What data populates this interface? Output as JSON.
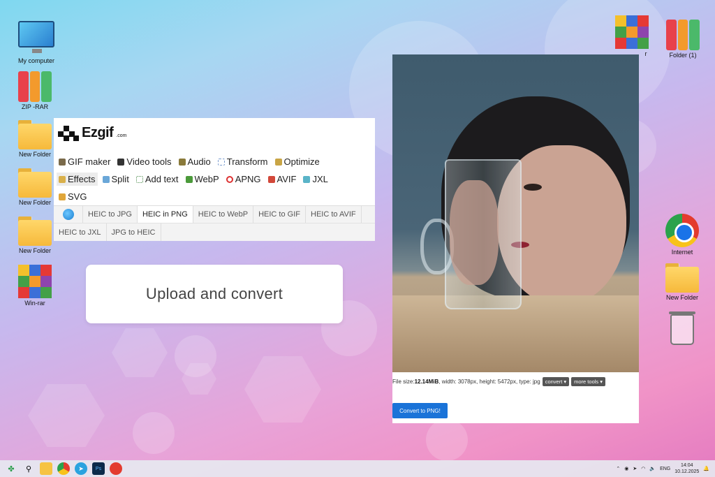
{
  "desktop": {
    "left_icons": [
      {
        "label": "My computer"
      },
      {
        "label": "ZIP -RAR"
      },
      {
        "label": "New Folder"
      },
      {
        "label": "New Folder"
      },
      {
        "label": "New Folder"
      },
      {
        "label": "Win-rar"
      }
    ],
    "right_icons": [
      {
        "label": "r"
      },
      {
        "label": "Folder (1)"
      },
      {
        "label": "Internet"
      },
      {
        "label": "New Folder"
      },
      {
        "label": ""
      }
    ]
  },
  "ezgif": {
    "logo_text": "Ezgif",
    "logo_suffix": ".com",
    "nav_rows": [
      [
        {
          "label": "GIF maker",
          "icon": "film-icon"
        },
        {
          "label": "Video tools",
          "icon": "clapper-icon"
        },
        {
          "label": "Audio",
          "icon": "speaker-icon"
        },
        {
          "label": "Transform",
          "icon": "transform-icon"
        },
        {
          "label": "Optimize",
          "icon": "broom-icon"
        }
      ],
      [
        {
          "label": "Effects",
          "icon": "wand-icon",
          "active": true
        },
        {
          "label": "Split",
          "icon": "scissors-icon"
        },
        {
          "label": "Add text",
          "icon": "text-icon"
        },
        {
          "label": "WebP",
          "icon": "webp-icon"
        },
        {
          "label": "APNG",
          "icon": "apng-icon"
        },
        {
          "label": "AVIF",
          "icon": "avif-icon"
        },
        {
          "label": "JXL",
          "icon": "jxl-icon"
        }
      ],
      [
        {
          "label": "SVG",
          "icon": "svg-icon"
        }
      ]
    ],
    "tabs_row1": [
      "HEIC to JPG",
      "HEIC in PNG",
      "HEIC to WebP",
      "HEIC to GIF",
      "HEIC to AVIF"
    ],
    "tabs_row2": [
      "HEIC to JXL",
      "JPG to HEIC"
    ],
    "active_tab": "HEIC in PNG"
  },
  "upload": {
    "label": "Upload and convert"
  },
  "file": {
    "size_label": "File size: ",
    "size_value": "12.14MiB",
    "details": ", width: 3078px, height: 5472px, type: jpg",
    "convert_dropdown": "convert ▾",
    "more_tools_dropdown": "more tools ▾",
    "convert_button": "Convert to PNG!"
  },
  "taskbar": {
    "lang": "ENG",
    "time": "14:04",
    "date": "10.12.2025"
  },
  "colors": {
    "accent_blue": "#1a73d8",
    "folder_yellow": "#f6b93b"
  }
}
